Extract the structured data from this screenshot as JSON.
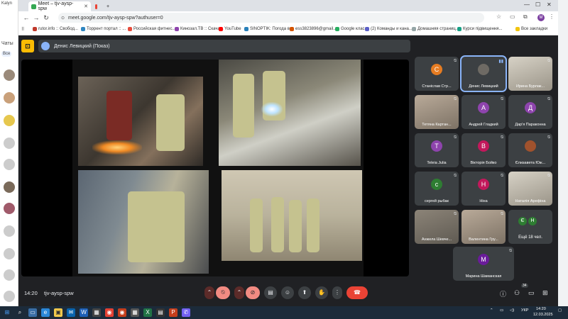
{
  "browser": {
    "tabs": [
      {
        "label": "Kalyn",
        "active": false
      },
      {
        "label": "Meet – tjv-aysp-spw",
        "active": true
      }
    ],
    "new_tab": "+",
    "url": "meet.google.com/tjv-aysp-spw?authuser=0",
    "profile_initial": "M",
    "bookmarks": [
      "rutor.info :: Свобод...",
      "Торрент портал :: ...",
      "Российская фитнес...",
      "Кинозал.ТВ :: Скача...",
      "YouTube",
      "SINOPTIK: Погода в...",
      "ess3823896@gmail...",
      "Google клас",
      "(2) Команды и кана...",
      "Домашняя страниц...",
      "Курси підвищення..."
    ],
    "all_bookmarks": "Все закладки"
  },
  "left_app": {
    "label": "Чаты",
    "filter": "Все"
  },
  "meet": {
    "presenter_label": "Денис Левицкий (Показ)",
    "time": "14:20",
    "meeting_code": "tjv-aysp-spw",
    "participant_badge": "34",
    "participants": [
      {
        "name": "Станіслав Стр...",
        "initial": "С",
        "color": "#e67c22",
        "video": false,
        "muted": true
      },
      {
        "name": "Денис Левицкий",
        "initial": "",
        "color": "#5f6368",
        "video": false,
        "muted": false,
        "speaking": true
      },
      {
        "name": "Ирина Бурлак...",
        "initial": "",
        "color": "#5f6368",
        "video": true,
        "muted": true
      },
      {
        "name": "Тетяна Картан...",
        "initial": "",
        "color": "#5f6368",
        "video": true,
        "muted": true
      },
      {
        "name": "Андрей Гладкий",
        "initial": "А",
        "color": "#8e44ad",
        "video": false,
        "muted": true
      },
      {
        "name": "Дар'я Параконна",
        "initial": "Д",
        "color": "#8e44ad",
        "video": false,
        "muted": true
      },
      {
        "name": "Teleia Julia",
        "initial": "T",
        "color": "#8e44ad",
        "video": false,
        "muted": true
      },
      {
        "name": "Вікторія Бойко",
        "initial": "В",
        "color": "#c2185b",
        "video": false,
        "muted": true
      },
      {
        "name": "Єлизавета Юж...",
        "initial": "",
        "color": "#5f6368",
        "video": true,
        "muted": true
      },
      {
        "name": "сергей рыбак",
        "initial": "с",
        "color": "#2e7d32",
        "video": false,
        "muted": true
      },
      {
        "name": "Ніна",
        "initial": "Н",
        "color": "#c2185b",
        "video": false,
        "muted": true
      },
      {
        "name": "Наталія Арефіна",
        "initial": "",
        "color": "#5f6368",
        "video": true,
        "muted": true
      },
      {
        "name": "Анжела Шевче...",
        "initial": "",
        "color": "#5f6368",
        "video": true,
        "muted": true
      },
      {
        "name": "Валентина Гру...",
        "initial": "",
        "color": "#5f6368",
        "video": true,
        "muted": true
      },
      {
        "name": "Марина Шаманская",
        "initial": "М",
        "color": "#6a1b9a",
        "video": false,
        "muted": true
      }
    ],
    "more_label": "Ещё 18 чел.",
    "more_initials": [
      "Є",
      "Н"
    ]
  },
  "taskbar": {
    "lang": "УКР",
    "clock_time": "14:20",
    "clock_date": "12.03.2025"
  }
}
